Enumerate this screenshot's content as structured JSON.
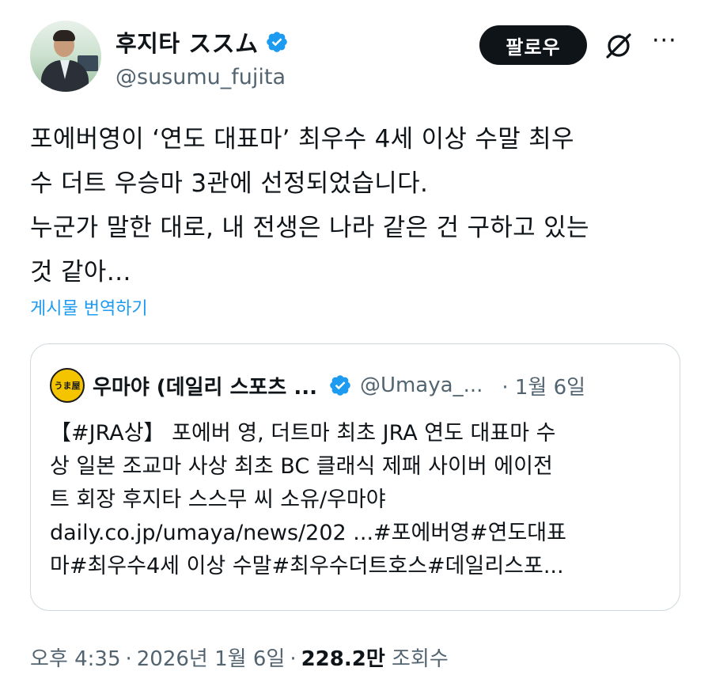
{
  "author": {
    "display_name": "후지타 ススム",
    "handle": "@susumu_fujita",
    "verified_icon": "verified-badge-icon"
  },
  "actions": {
    "follow_label": "팔로우",
    "grok_icon": "grok-icon",
    "more_icon": "more-icon"
  },
  "tweet": {
    "lines": [
      "포에버영이 ‘연도 대표마’ 최우수 4세 이상 수말 최우",
      "수 더트 우승마 3관에 선정되었습니다.",
      "누군가 말한 대로, 내 전생은 나라 같은 건 구하고 있는",
      "것 같아…"
    ],
    "translate_label": "게시물 번역하기"
  },
  "quote": {
    "avatar_text": "うま屋",
    "name": "우마야 (데일리 스포츠 ...",
    "handle": "@Umaya_...",
    "date": "· 1월 6일",
    "body_lines": [
      "【#JRA상】 포에버 영, 더트마 최초 JRA 연도 대표마 수",
      "상 일본 조교마 사상 최초 BC 클래식 제패 사이버 에이전",
      "트 회장 후지타 스스무 씨 소유/우마야",
      "daily.co.jp/umaya/news/202 ...#포에버영#연도대표",
      "마#최우수4세 이상 수말#최우수더트호스#데일리스포..."
    ]
  },
  "meta": {
    "time": "오후 4:35",
    "date": "2026년 1월 6일",
    "separator": "·",
    "views_count": "228.2만",
    "views_label": "조회수"
  },
  "colors": {
    "accent": "#1d9bf0",
    "secondary_text": "#536471",
    "primary_text": "#0f1419"
  }
}
